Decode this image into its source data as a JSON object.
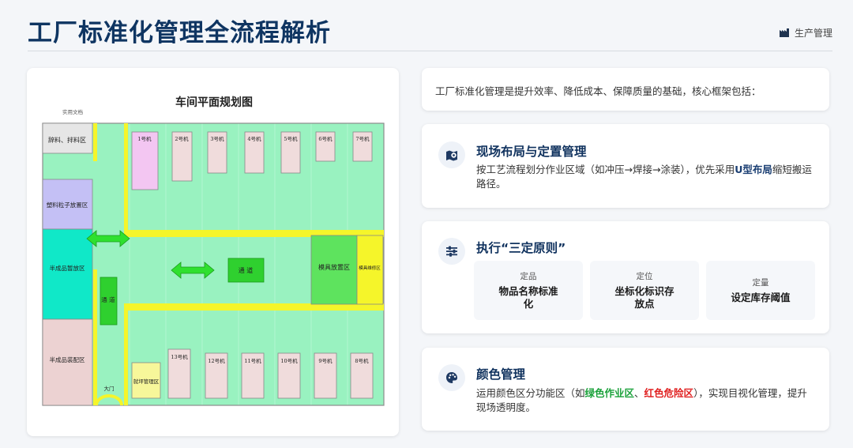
{
  "header": {
    "title": "工厂标准化管理全流程解析",
    "tag_label": "生产管理",
    "tag_icon": "factory-icon"
  },
  "plan": {
    "title": "车间平面规划图",
    "label_top_small": "实用文档",
    "zone_raw_material": "辞料、拌料区",
    "zone_plastic": "塑料粒子放置区",
    "zone_semi_temp": "半成品暂放区",
    "zone_semi_assembly": "半成品装配区",
    "zone_mold": "模具放置区",
    "zone_mold_repair": "模具维修区",
    "zone_aisle_center": "通 道",
    "zone_aisle_vertical": "通 道",
    "zone_gate": "大门",
    "zone_office": "就坪管理区",
    "machines_top": [
      "1号机",
      "2号机",
      "3号机",
      "4号机",
      "5号机",
      "6号机",
      "7号机"
    ],
    "machines_bottom": [
      "13号机",
      "12号机",
      "11号机",
      "10号机",
      "9号机",
      "8号机"
    ]
  },
  "intro": {
    "text": "工厂标准化管理是提升效率、降低成本、保障质量的基础，核心框架包括："
  },
  "sections": [
    {
      "icon": "location-pin-icon",
      "title": "现场布局与定置管理",
      "body_before": "按工艺流程划分作业区域（如冲压→焊接→涂装），优先采用",
      "body_bold": "U型布局",
      "body_after": "缩短搬运路径。"
    },
    {
      "icon": "sliders-icon",
      "title": "执行“三定原则”",
      "principles": [
        {
          "label": "定品",
          "value": "物品名称标准化"
        },
        {
          "label": "定位",
          "value": "坐标化标识存放点"
        },
        {
          "label": "定量",
          "value": "设定库存阈值"
        }
      ]
    },
    {
      "icon": "palette-icon",
      "title": "颜色管理",
      "body_before": "运用颜色区分功能区（如",
      "body_green": "绿色作业区",
      "body_sep": "、",
      "body_red": "红色危险区",
      "body_after": "），实现目视化管理，提升现场透明度。"
    }
  ],
  "colors": {
    "title_navy": "#0f3562",
    "floor_green": "#99f2c0",
    "aisle_yellow": "#f5f52a",
    "arrow_green": "#2fe02f",
    "highlight_green": "#1aa13a",
    "highlight_red": "#e02020"
  }
}
